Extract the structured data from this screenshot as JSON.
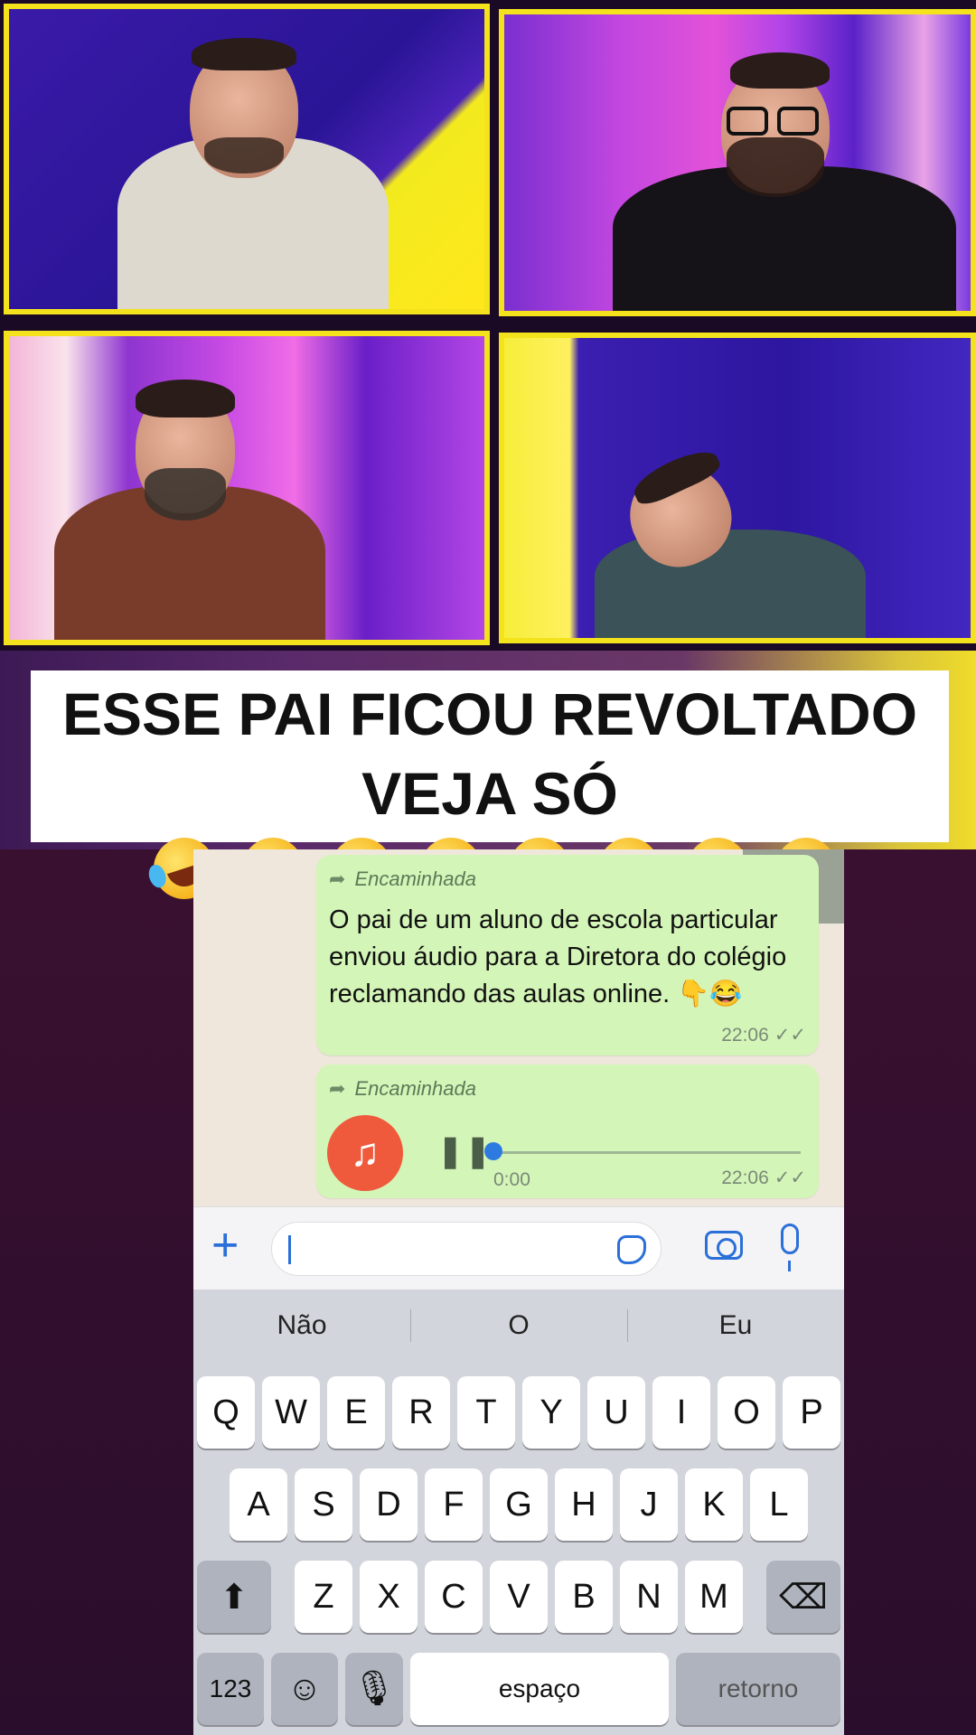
{
  "caption": {
    "line1": "ESSE PAI FICOU REVOLTADO",
    "line2": "VEJA SÓ",
    "emoji_icon": "rolling-on-floor-laughing",
    "emoji_count": 8
  },
  "chat": {
    "messages": [
      {
        "forwarded_label": "Encaminhada",
        "text": "O pai de um aluno de escola particular enviou áudio para a Diretora do colégio reclamando das aulas online. 👇😂",
        "time": "22:06",
        "status_icon": "double-check-icon"
      },
      {
        "forwarded_label": "Encaminhada",
        "type": "audio",
        "audio_elapsed": "0:00",
        "audio_progress": 0,
        "time": "22:06",
        "status_icon": "double-check-icon"
      }
    ],
    "bubble_color": "#d4f5b8"
  },
  "input_bar": {
    "value": "",
    "accent_color": "#2b6fd8"
  },
  "keyboard": {
    "suggestions": [
      "Não",
      "O",
      "Eu"
    ],
    "row1": [
      "Q",
      "W",
      "E",
      "R",
      "T",
      "Y",
      "U",
      "I",
      "O",
      "P"
    ],
    "row2": [
      "A",
      "S",
      "D",
      "F",
      "G",
      "H",
      "J",
      "K",
      "L"
    ],
    "row3": [
      "Z",
      "X",
      "C",
      "V",
      "B",
      "N",
      "M"
    ],
    "numbers_key": "123",
    "space_key": "espaço",
    "return_key": "retorno"
  },
  "colors": {
    "panel_border": "#f4e21c",
    "audio_icon": "#ef5a3c"
  }
}
